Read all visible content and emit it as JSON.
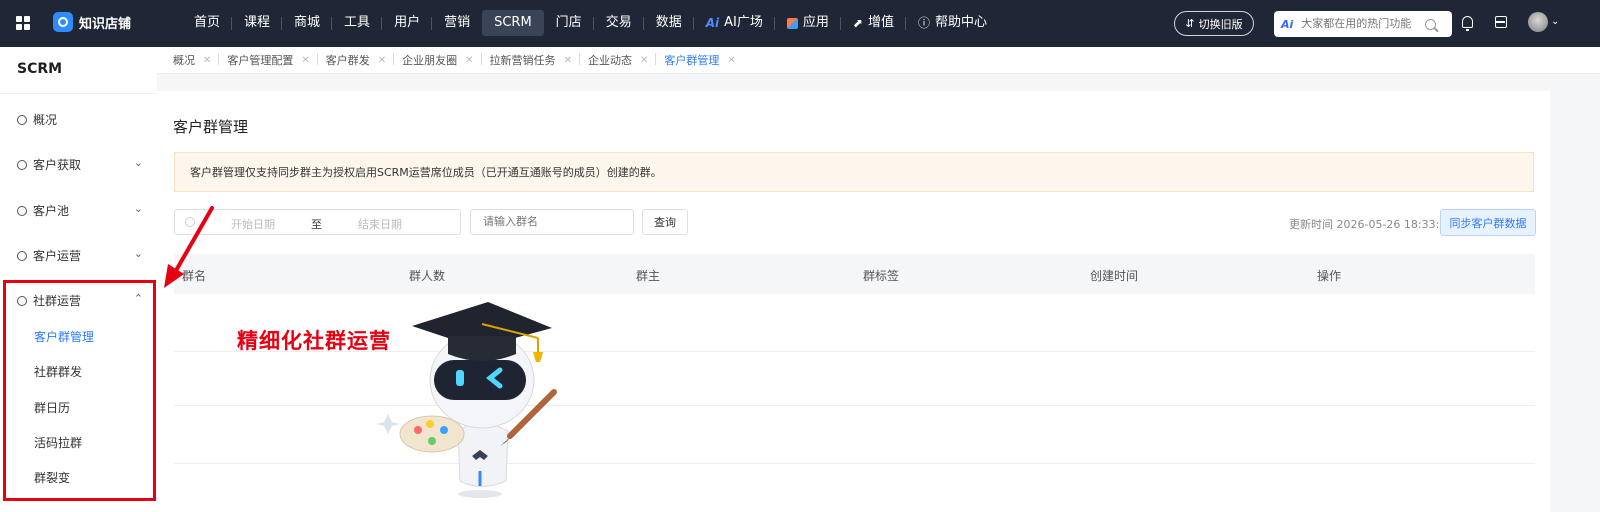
{
  "app": {
    "brand": "知识店铺"
  },
  "nav": {
    "items": [
      {
        "label": "首页"
      },
      {
        "label": "课程"
      },
      {
        "label": "商城"
      },
      {
        "label": "工具"
      },
      {
        "label": "用户"
      },
      {
        "label": "营销"
      },
      {
        "label": "SCRM",
        "active": true
      },
      {
        "label": "门店"
      },
      {
        "label": "交易"
      },
      {
        "label": "数据"
      },
      {
        "label": "AI广场",
        "icon": "ai-icon"
      },
      {
        "label": "应用",
        "icon": "cube-icon"
      },
      {
        "label": "增值",
        "icon": "trend-icon"
      },
      {
        "label": "帮助中心",
        "icon": "help-icon"
      }
    ]
  },
  "header": {
    "switch_label": "切换旧版",
    "search_ai": "Ai",
    "search_placeholder": "大家都在用的热门功能"
  },
  "sidebar": {
    "title": "SCRM",
    "items": [
      {
        "label": "概况",
        "icon": "pie-chart-icon"
      },
      {
        "label": "客户获取",
        "icon": "user-icon"
      },
      {
        "label": "客户池",
        "icon": "user-icon"
      },
      {
        "label": "客户运营",
        "icon": "users-icon"
      },
      {
        "label": "社群运营",
        "icon": "chat-icon",
        "expanded": true
      }
    ],
    "subitems": [
      {
        "label": "客户群管理",
        "active": true
      },
      {
        "label": "社群群发"
      },
      {
        "label": "群日历"
      },
      {
        "label": "活码拉群"
      },
      {
        "label": "群裂变"
      }
    ]
  },
  "tabs": [
    {
      "label": "概况"
    },
    {
      "label": "客户管理配置"
    },
    {
      "label": "客户群发"
    },
    {
      "label": "企业朋友圈"
    },
    {
      "label": "拉新营销任务"
    },
    {
      "label": "企业动态"
    },
    {
      "label": "客户群管理",
      "active": true
    }
  ],
  "main": {
    "title": "客户群管理",
    "notice": "客户群管理仅支持同步群主为授权启用SCRM运营席位成员（已开通互通账号的成员）创建的群。",
    "filters": {
      "start_placeholder": "开始日期",
      "to": "至",
      "end_placeholder": "结束日期",
      "name_placeholder": "请输入群名",
      "query_label": "查询"
    },
    "update_time": "更新时间 2026-05-26 18:33:24",
    "sync_label": "同步客户群数据",
    "table": {
      "columns": [
        "群名",
        "群人数",
        "群主",
        "群标签",
        "创建时间",
        "操作"
      ]
    }
  },
  "overlay": {
    "promo_text": "精细化社群运营",
    "accent": "#e60012"
  }
}
